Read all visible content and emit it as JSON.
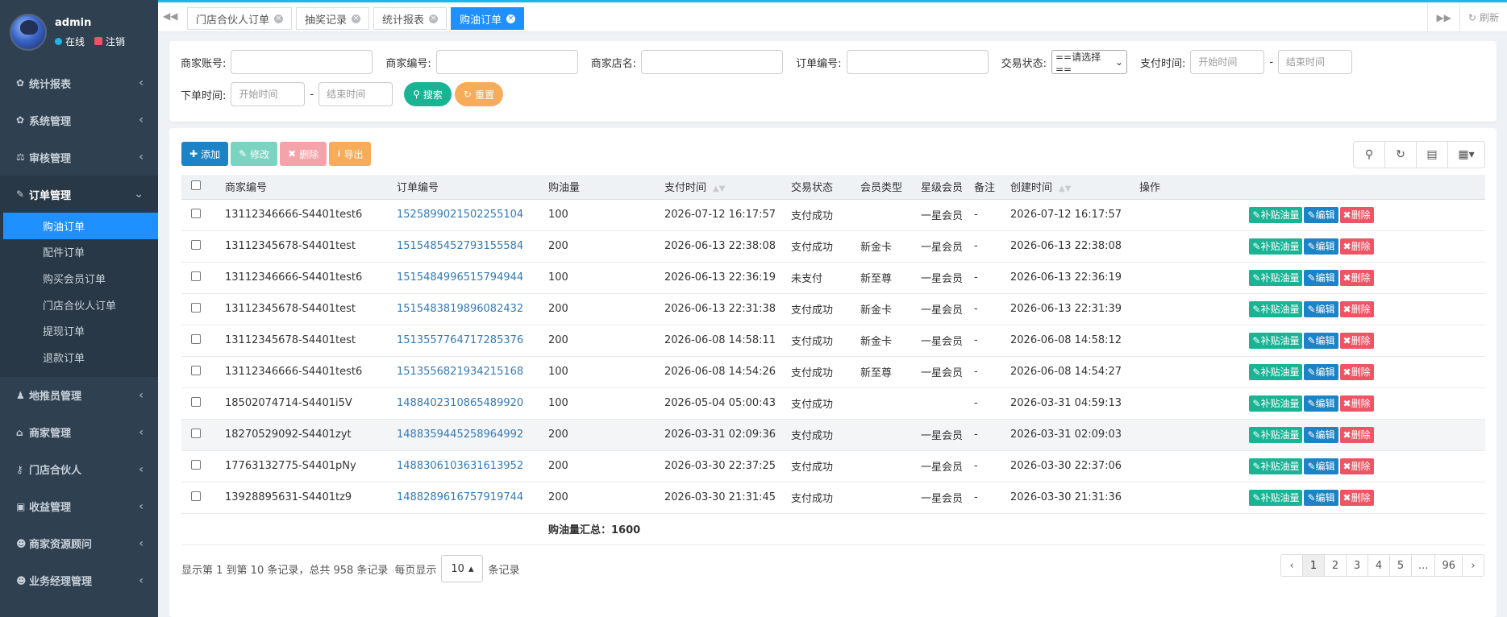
{
  "user": {
    "name": "admin",
    "status": "在线",
    "logout": "注销"
  },
  "sidebar": {
    "items": [
      {
        "label": "统计报表",
        "icon": "gear-icon",
        "glyph": "✿"
      },
      {
        "label": "系统管理",
        "icon": "gear-icon",
        "glyph": "✿"
      },
      {
        "label": "审核管理",
        "icon": "balance-icon",
        "glyph": "⚖"
      },
      {
        "label": "订单管理",
        "icon": "pen-icon",
        "glyph": "✎"
      }
    ],
    "submenu": [
      {
        "label": "购油订单"
      },
      {
        "label": "配件订单"
      },
      {
        "label": "购买会员订单"
      },
      {
        "label": "门店合伙人订单"
      },
      {
        "label": "提现订单"
      },
      {
        "label": "退款订单"
      }
    ],
    "items_after": [
      {
        "label": "地推员管理",
        "icon": "person-icon",
        "glyph": "♟"
      },
      {
        "label": "商家管理",
        "icon": "bank-icon",
        "glyph": "⌂"
      },
      {
        "label": "门店合伙人",
        "icon": "key-icon",
        "glyph": "⚷"
      },
      {
        "label": "收益管理",
        "icon": "money-icon",
        "glyph": "▣"
      },
      {
        "label": "商家资源顾问",
        "icon": "group-icon",
        "glyph": "☻"
      },
      {
        "label": "业务经理管理",
        "icon": "group-icon",
        "glyph": "☻"
      }
    ]
  },
  "tabs": [
    {
      "label": "门店合伙人订单"
    },
    {
      "label": "抽奖记录"
    },
    {
      "label": "统计报表"
    },
    {
      "label": "购油订单"
    }
  ],
  "tabbar": {
    "refresh": "刷新"
  },
  "search": {
    "merchant_account": "商家账号:",
    "merchant_no": "商家编号:",
    "store_name": "商家店名:",
    "order_no": "订单编号:",
    "trade_status": "交易状态:",
    "trade_status_value": "==请选择==",
    "pay_time": "支付时间:",
    "order_time": "下单时间:",
    "start_placeholder": "开始时间",
    "end_placeholder": "结束时间",
    "search_btn": "搜索",
    "reset_btn": "重置"
  },
  "toolbar": {
    "add": "添加",
    "edit": "修改",
    "delete": "删除",
    "export": "导出"
  },
  "table": {
    "headers": [
      "商家编号",
      "订单编号",
      "购油量",
      "支付时间",
      "交易状态",
      "会员类型",
      "星级会员",
      "备注",
      "创建时间",
      "操作"
    ],
    "rows": [
      {
        "merchant": "13112346666-S4401test6",
        "order": "1525899021502255104",
        "qty": "100",
        "pay": "2026-07-12 16:17:57",
        "status": "支付成功",
        "member": "",
        "star": "一星会员",
        "note": "-",
        "created": "2026-07-12 16:17:57"
      },
      {
        "merchant": "13112345678-S4401test",
        "order": "1515485452793155584",
        "qty": "200",
        "pay": "2026-06-13 22:38:08",
        "status": "支付成功",
        "member": "新金卡",
        "star": "一星会员",
        "note": "-",
        "created": "2026-06-13 22:38:08"
      },
      {
        "merchant": "13112346666-S4401test6",
        "order": "1515484996515794944",
        "qty": "100",
        "pay": "2026-06-13 22:36:19",
        "status": "未支付",
        "member": "新至尊",
        "star": "一星会员",
        "note": "-",
        "created": "2026-06-13 22:36:19"
      },
      {
        "merchant": "13112345678-S4401test",
        "order": "1515483819896082432",
        "qty": "200",
        "pay": "2026-06-13 22:31:38",
        "status": "支付成功",
        "member": "新金卡",
        "star": "一星会员",
        "note": "-",
        "created": "2026-06-13 22:31:39"
      },
      {
        "merchant": "13112345678-S4401test",
        "order": "1513557764717285376",
        "qty": "200",
        "pay": "2026-06-08 14:58:11",
        "status": "支付成功",
        "member": "新金卡",
        "star": "一星会员",
        "note": "-",
        "created": "2026-06-08 14:58:12"
      },
      {
        "merchant": "13112346666-S4401test6",
        "order": "1513556821934215168",
        "qty": "100",
        "pay": "2026-06-08 14:54:26",
        "status": "支付成功",
        "member": "新至尊",
        "star": "一星会员",
        "note": "-",
        "created": "2026-06-08 14:54:27"
      },
      {
        "merchant": "18502074714-S4401i5V",
        "order": "1488402310865489920",
        "qty": "100",
        "pay": "2026-05-04 05:00:43",
        "status": "支付成功",
        "member": "",
        "star": "",
        "note": "-",
        "created": "2026-03-31 04:59:13"
      },
      {
        "merchant": "18270529092-S4401zyt",
        "order": "1488359445258964992",
        "qty": "200",
        "pay": "2026-03-31 02:09:36",
        "status": "支付成功",
        "member": "",
        "star": "一星会员",
        "note": "-",
        "created": "2026-03-31 02:09:03"
      },
      {
        "merchant": "17763132775-S4401pNy",
        "order": "1488306103631613952",
        "qty": "200",
        "pay": "2026-03-30 22:37:25",
        "status": "支付成功",
        "member": "",
        "star": "一星会员",
        "note": "-",
        "created": "2026-03-30 22:37:06"
      },
      {
        "merchant": "13928895631-S4401tz9",
        "order": "1488289616757919744",
        "qty": "200",
        "pay": "2026-03-30 21:31:45",
        "status": "支付成功",
        "member": "",
        "star": "一星会员",
        "note": "-",
        "created": "2026-03-30 21:31:36"
      }
    ],
    "ops": {
      "topup": "补贴油量",
      "edit": "编辑",
      "delete": "删除"
    },
    "summary": "购油量汇总：1600"
  },
  "pager": {
    "info": "显示第 1 到第 10 条记录，总共 958 条记录",
    "per_page_prefix": "每页显示",
    "per_page_value": "10",
    "per_page_suffix": "条记录",
    "pages": [
      "‹",
      "1",
      "2",
      "3",
      "4",
      "5",
      "...",
      "96",
      "›"
    ]
  }
}
